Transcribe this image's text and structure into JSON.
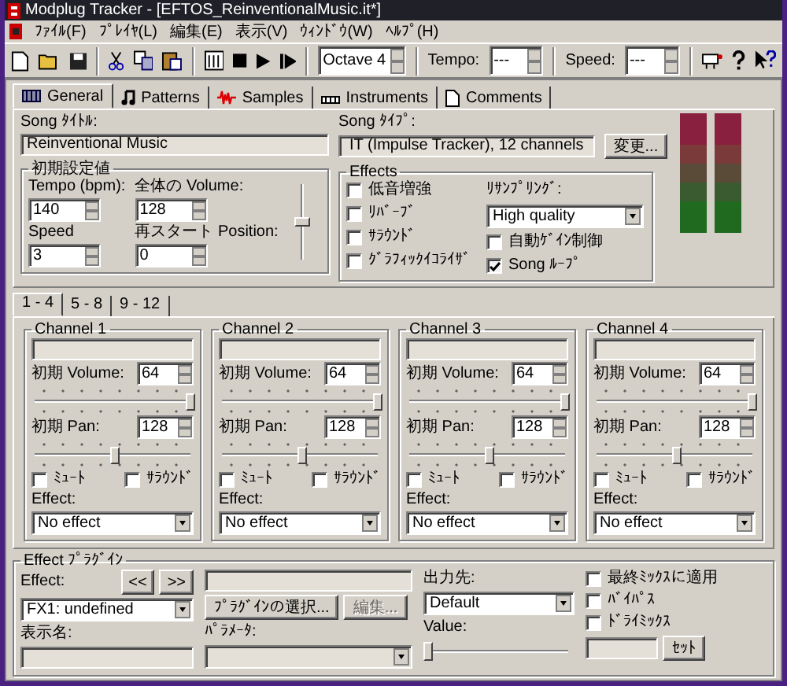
{
  "window": {
    "title": "Modplug Tracker - [EFTOS_ReinventionalMusic.it*]"
  },
  "menu": [
    "ﾌｧｲﾙ(F)",
    "ﾌﾟﾚｲﾔ(L)",
    "編集(E)",
    "表示(V)",
    "ｳｨﾝﾄﾞｳ(W)",
    "ﾍﾙﾌﾟ(H)"
  ],
  "toolbar": {
    "octave": "Octave 4",
    "tempo_label": "Tempo:",
    "tempo": "---",
    "speed_label": "Speed:",
    "speed": "---"
  },
  "tabs": [
    {
      "label": "General",
      "selected": true
    },
    {
      "label": "Patterns",
      "selected": false
    },
    {
      "label": "Samples",
      "selected": false
    },
    {
      "label": "Instruments",
      "selected": false
    },
    {
      "label": "Comments",
      "selected": false
    }
  ],
  "song": {
    "title_label": "Song ﾀｲﾄﾙ:",
    "title": "Reinventional Music",
    "type_label": "Song ﾀｲﾌﾟ:",
    "type": "IT (Impulse Tracker), 12 channels",
    "change_button": "変更..."
  },
  "initial": {
    "title": "初期設定値",
    "tempo_label": "Tempo (bpm):",
    "tempo": "140",
    "volume_label": "全体の Volume:",
    "volume": "128",
    "speed_label": "Speed",
    "speed": "3",
    "restart_label": "再スタート Position:",
    "restart": "0",
    "master_volume": {
      "level": 0.5
    }
  },
  "effects": {
    "title": "Effects",
    "options": [
      {
        "label": "低音増強",
        "checked": false
      },
      {
        "label": "ﾘﾊﾞｰﾌﾞ",
        "checked": false
      },
      {
        "label": "ｻﾗｳﾝﾄﾞ",
        "checked": false
      },
      {
        "label": "ｸﾞﾗﾌｨｯｸｲｺﾗｲｻﾞ",
        "checked": false
      }
    ],
    "resampling_label": "ﾘｻﾝﾌﾟﾘﾝｸﾞ:",
    "resampling": "High quality",
    "right_options": [
      {
        "label": "自動ｹﾞｲﾝ制御",
        "checked": false
      },
      {
        "label": "Song ﾙｰﾌﾟ",
        "checked": true
      }
    ]
  },
  "channel_tabs": [
    {
      "label": "1 - 4",
      "selected": true
    },
    {
      "label": "5 - 8",
      "selected": false
    },
    {
      "label": "9 - 12",
      "selected": false
    }
  ],
  "channels": [
    {
      "title": "Channel 1",
      "volume_label": "初期 Volume:",
      "volume": "64",
      "volume_slider": {
        "level": 1
      },
      "pan_label": "初期 Pan:",
      "pan": "128",
      "pan_slider": {
        "level": 0.5
      },
      "mute": {
        "label": "ﾐｭｰﾄ",
        "checked": false
      },
      "surround": {
        "label": "ｻﾗｳﾝﾄﾞ",
        "checked": false
      },
      "effect_label": "Effect:",
      "effect": "No effect"
    },
    {
      "title": "Channel 2",
      "volume_label": "初期 Volume:",
      "volume": "64",
      "volume_slider": {
        "level": 1
      },
      "pan_label": "初期 Pan:",
      "pan": "128",
      "pan_slider": {
        "level": 0.5
      },
      "mute": {
        "label": "ﾐｭｰﾄ",
        "checked": false
      },
      "surround": {
        "label": "ｻﾗｳﾝﾄﾞ",
        "checked": false
      },
      "effect_label": "Effect:",
      "effect": "No effect"
    },
    {
      "title": "Channel 3",
      "volume_label": "初期 Volume:",
      "volume": "64",
      "volume_slider": {
        "level": 1
      },
      "pan_label": "初期 Pan:",
      "pan": "128",
      "pan_slider": {
        "level": 0.5
      },
      "mute": {
        "label": "ﾐｭｰﾄ",
        "checked": false
      },
      "surround": {
        "label": "ｻﾗｳﾝﾄﾞ",
        "checked": false
      },
      "effect_label": "Effect:",
      "effect": "No effect"
    },
    {
      "title": "Channel 4",
      "volume_label": "初期 Volume:",
      "volume": "64",
      "volume_slider": {
        "level": 1
      },
      "pan_label": "初期 Pan:",
      "pan": "128",
      "pan_slider": {
        "level": 0.5
      },
      "mute": {
        "label": "ﾐｭｰﾄ",
        "checked": false
      },
      "surround": {
        "label": "ｻﾗｳﾝﾄﾞ",
        "checked": false
      },
      "effect_label": "Effect:",
      "effect": "No effect"
    }
  ],
  "plugin": {
    "title": "Effect ﾌﾟﾗｸﾞｲﾝ",
    "effect_label": "Effect:",
    "prev_button": "<<",
    "next_button": ">>",
    "effect": "FX1: undefined",
    "select_button": "ﾌﾟﾗｸﾞｲﾝの選択...",
    "edit_button": "編集...",
    "edit_disabled": true,
    "name_label": "表示名:",
    "param_label": "ﾊﾟﾗﾒｰﾀ:",
    "output_label": "出力先:",
    "output": "Default",
    "value_label": "Value:",
    "value_slider": {
      "level": 0
    },
    "options": [
      {
        "label": "最終ﾐｯｸｽに適用",
        "checked": false
      },
      {
        "label": "ﾊﾞｲﾊﾟｽ",
        "checked": false
      },
      {
        "label": "ﾄﾞﾗｲﾐｯｸｽ",
        "checked": false
      }
    ],
    "set_button": "ｾｯﾄ"
  }
}
